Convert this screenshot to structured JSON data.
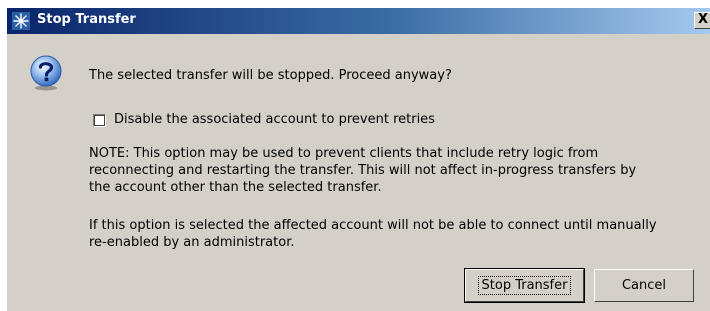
{
  "dialog": {
    "title": "Stop Transfer",
    "close_glyph": "X",
    "title_icon": "sparkle-icon",
    "message_icon": "question-icon",
    "message": "The selected transfer will be stopped. Proceed anyway?",
    "checkbox": {
      "label": "Disable the associated account to prevent retries",
      "checked": false
    },
    "note_lines": [
      "NOTE: This option may be used to prevent clients that include retry logic from",
      "reconnecting and restarting the transfer. This will not affect in-progress transfers by",
      "the account other than the selected transfer."
    ],
    "info_lines": [
      "If this option is selected the affected account will not be able to connect until manually",
      "re-enabled by an administrator."
    ],
    "buttons": {
      "stop_label": "Stop Transfer",
      "cancel_label": "Cancel"
    }
  }
}
